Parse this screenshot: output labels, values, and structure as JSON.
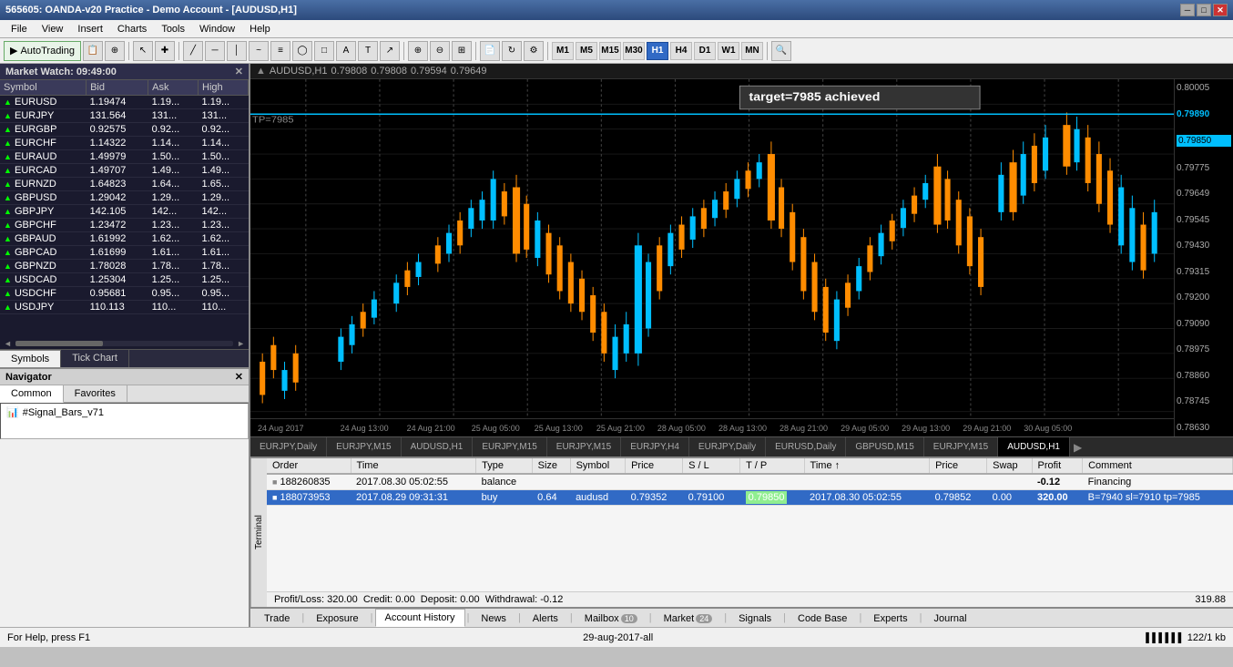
{
  "titleBar": {
    "text": "565605: OANDA-v20 Practice - Demo Account - [AUDUSD,H1]",
    "controls": [
      "minimize",
      "maximize",
      "close"
    ]
  },
  "menuBar": {
    "items": [
      "File",
      "View",
      "Insert",
      "Charts",
      "Tools",
      "Window",
      "Help"
    ]
  },
  "toolbar": {
    "autoTrading": "AutoTrading",
    "timeframes": [
      "M1",
      "M5",
      "M15",
      "M30",
      "H1",
      "H4",
      "D1",
      "W1",
      "MN"
    ],
    "activeTimeframe": "H1"
  },
  "marketWatch": {
    "title": "Market Watch: 09:49:00",
    "columns": [
      "Symbol",
      "Bid",
      "Ask",
      "High"
    ],
    "rows": [
      {
        "symbol": "EURUSD",
        "bid": "1.19474",
        "ask": "1.19...",
        "high": "1.19..."
      },
      {
        "symbol": "EURJPY",
        "bid": "131.564",
        "ask": "131...",
        "high": "131..."
      },
      {
        "symbol": "EURGBP",
        "bid": "0.92575",
        "ask": "0.92...",
        "high": "0.92..."
      },
      {
        "symbol": "EURCHF",
        "bid": "1.14322",
        "ask": "1.14...",
        "high": "1.14..."
      },
      {
        "symbol": "EURAUD",
        "bid": "1.49979",
        "ask": "1.50...",
        "high": "1.50..."
      },
      {
        "symbol": "EURCAD",
        "bid": "1.49707",
        "ask": "1.49...",
        "high": "1.49..."
      },
      {
        "symbol": "EURNZD",
        "bid": "1.64823",
        "ask": "1.64...",
        "high": "1.65..."
      },
      {
        "symbol": "GBPUSD",
        "bid": "1.29042",
        "ask": "1.29...",
        "high": "1.29..."
      },
      {
        "symbol": "GBPJPY",
        "bid": "142.105",
        "ask": "142...",
        "high": "142..."
      },
      {
        "symbol": "GBPCHF",
        "bid": "1.23472",
        "ask": "1.23...",
        "high": "1.23..."
      },
      {
        "symbol": "GBPAUD",
        "bid": "1.61992",
        "ask": "1.62...",
        "high": "1.62..."
      },
      {
        "symbol": "GBPCAD",
        "bid": "1.61699",
        "ask": "1.61...",
        "high": "1.61..."
      },
      {
        "symbol": "GBPNZD",
        "bid": "1.78028",
        "ask": "1.78...",
        "high": "1.78..."
      },
      {
        "symbol": "USDCAD",
        "bid": "1.25304",
        "ask": "1.25...",
        "high": "1.25..."
      },
      {
        "symbol": "USDCHF",
        "bid": "0.95681",
        "ask": "0.95...",
        "high": "0.95..."
      },
      {
        "symbol": "USDJPY",
        "bid": "110.113",
        "ask": "110...",
        "high": "110..."
      }
    ],
    "tabs": [
      "Symbols",
      "Tick Chart"
    ]
  },
  "navigator": {
    "title": "Navigator",
    "tabs": [
      "Common",
      "Favorites"
    ],
    "activeTab": "Common",
    "items": [
      "#Signal_Bars_v71"
    ]
  },
  "chart": {
    "symbol": "AUDUSD",
    "timeframe": "H1",
    "price": "0.79808",
    "bid": "0.79808",
    "ask": "0.79808",
    "range": "0.79594",
    "range2": "0.79649",
    "annotation": "target=7985 achieved",
    "tpLabel": "TP=7985",
    "priceScaleValues": [
      "0.80005",
      "0.79890",
      "0.79850",
      "0.79775",
      "0.79649",
      "0.79545",
      "0.79430",
      "0.79315",
      "0.79200",
      "0.79090",
      "0.78975",
      "0.78860",
      "0.78745",
      "0.78630"
    ],
    "timeLabels": [
      "24 Aug 2017",
      "24 Aug 13:00",
      "24 Aug 21:00",
      "25 Aug 05:00",
      "25 Aug 13:00",
      "25 Aug 21:00",
      "28 Aug 05:00",
      "28 Aug 13:00",
      "28 Aug 21:00",
      "29 Aug 05:00",
      "29 Aug 13:00",
      "29 Aug 21:00",
      "30 Aug 05:00"
    ],
    "tabs": [
      "EURJPY,Daily",
      "EURJPY,M15",
      "AUDUSD,H1",
      "EURJPY,M15",
      "EURJPY,M15",
      "EURJPY,H4",
      "EURJPY,Daily",
      "EURUSD,Daily",
      "GBPUSD,M15",
      "EURJPY,M15",
      "AUDUSD,H1"
    ],
    "activeTab": "AUDUSD,H1"
  },
  "terminal": {
    "columns": [
      "Order",
      "Time",
      "Type",
      "Size",
      "Symbol",
      "Price",
      "S / L",
      "T / P",
      "Time",
      "Price",
      "Swap",
      "Profit",
      "Comment"
    ],
    "rows": [
      {
        "order": "188260835",
        "time": "2017.08.30 05:02:55",
        "type": "balance",
        "size": "",
        "symbol": "",
        "price": "",
        "sl": "",
        "tp": "",
        "time2": "",
        "price2": "",
        "swap": "",
        "profit": "-0.12",
        "comment": "Financing",
        "selected": false
      },
      {
        "order": "188073953",
        "time": "2017.08.29 09:31:31",
        "type": "buy",
        "size": "0.64",
        "symbol": "audusd",
        "price": "0.79352",
        "sl": "0.79100",
        "tp": "0.79850",
        "time2": "2017.08.30 05:02:55",
        "price2": "0.79852",
        "swap": "0.00",
        "profit": "320.00",
        "comment": "B=7940 sl=7910 tp=7985",
        "selected": true
      }
    ],
    "footer": {
      "profitLoss": "Profit/Loss: 320.00",
      "credit": "Credit: 0.00",
      "deposit": "Deposit: 0.00",
      "withdrawal": "Withdrawal: -0.12",
      "total": "319.88"
    }
  },
  "bottomTabs": {
    "tabs": [
      "Trade",
      "Exposure",
      "Account History",
      "News",
      "Alerts",
      "Mailbox",
      "Market",
      "Signals",
      "Code Base",
      "Experts",
      "Journal"
    ],
    "activeTab": "Account History",
    "badges": {
      "Mailbox": "10",
      "Market": "24"
    }
  },
  "statusBar": {
    "helpText": "For Help, press F1",
    "dateFilter": "29-aug-2017-all",
    "memoryInfo": "122/1 kb"
  }
}
